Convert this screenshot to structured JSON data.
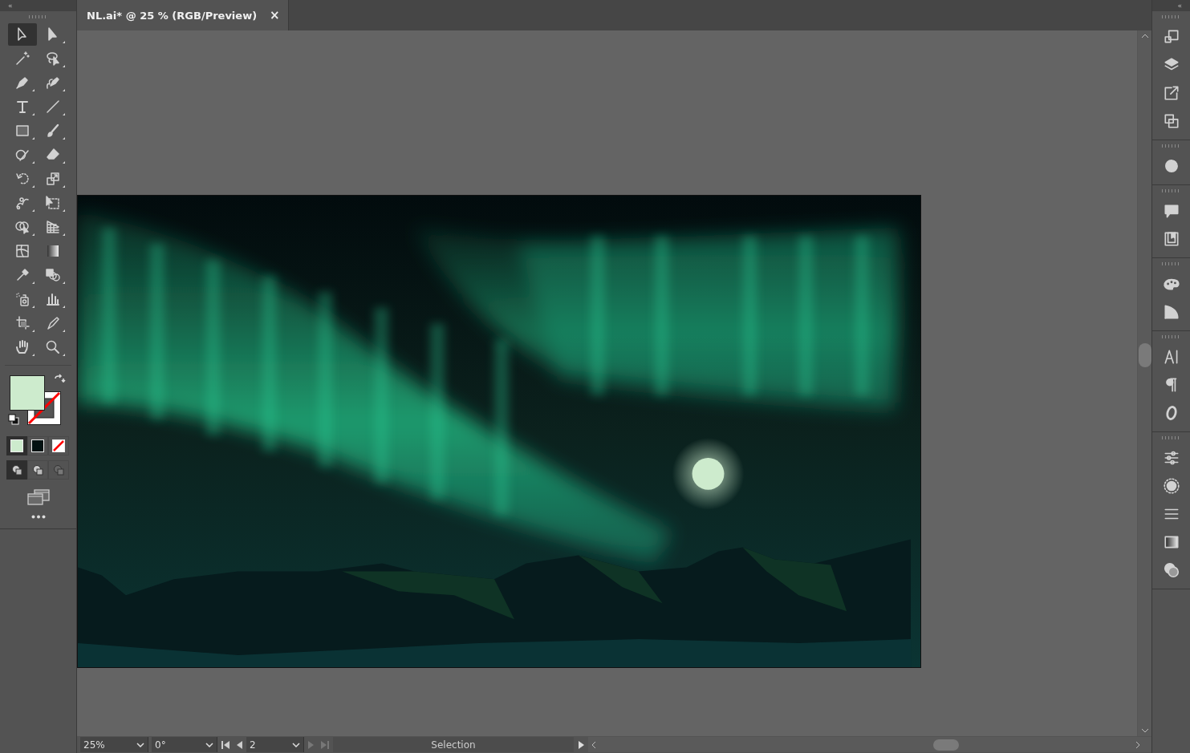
{
  "left_panel": {
    "collapse_glyph": "«"
  },
  "right_panel": {
    "collapse_glyph": "«"
  },
  "document_tab": {
    "title": "NL.ai* @ 25 % (RGB/Preview)",
    "close": "×"
  },
  "tools": [
    {
      "selected": true
    },
    {
      "selected": false
    },
    {
      "selected": false
    },
    {
      "selected": false
    },
    {
      "selected": false
    },
    {
      "selected": false
    },
    {
      "selected": false
    },
    {
      "selected": false
    },
    {
      "selected": false
    },
    {
      "selected": false
    },
    {
      "selected": false
    },
    {
      "selected": false
    },
    {
      "selected": false
    },
    {
      "selected": false
    },
    {
      "selected": false
    },
    {
      "selected": false
    },
    {
      "selected": false
    },
    {
      "selected": false
    },
    {
      "selected": false
    },
    {
      "selected": false
    },
    {
      "selected": false
    },
    {
      "selected": false
    },
    {
      "selected": false
    },
    {
      "selected": false
    },
    {
      "selected": false
    },
    {
      "selected": false
    },
    {
      "selected": false
    },
    {
      "selected": false
    }
  ],
  "color_modes": [
    {
      "selected": true
    },
    {
      "selected": false
    },
    {
      "selected": false
    }
  ],
  "draw_modes": [
    {
      "selected": true
    },
    {
      "selected": false
    },
    {
      "selected": false
    }
  ],
  "status_bar": {
    "zoom": "25%",
    "rotation": "0°",
    "artboard": "2",
    "status": "Selection"
  }
}
